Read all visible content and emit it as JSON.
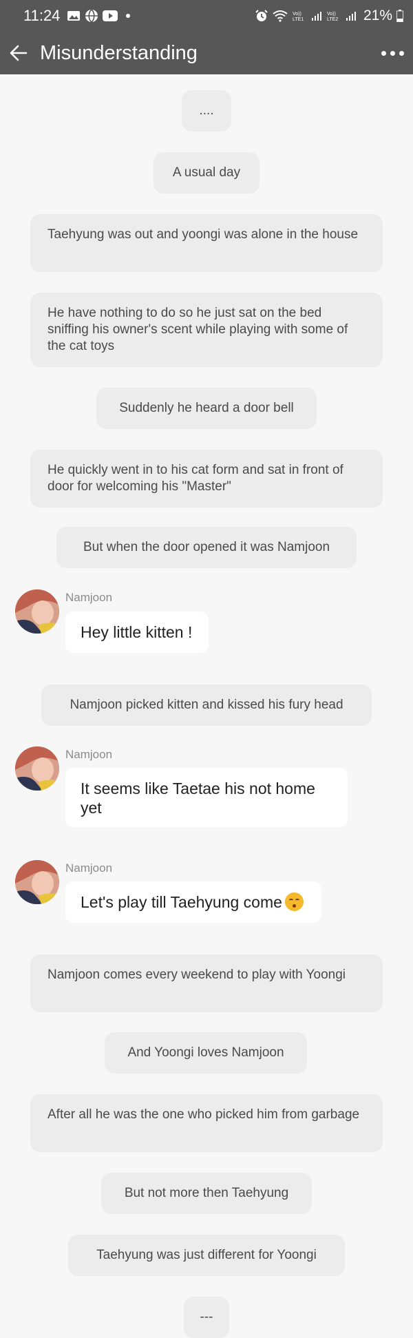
{
  "status_bar": {
    "time": "11:24",
    "battery": "21%",
    "icons": [
      "image-icon",
      "globe-icon",
      "youtube-icon",
      "notification-dot",
      "alarm-icon",
      "wifi-icon",
      "volte-lte1-icon",
      "signal-icon",
      "volte-lte2-icon",
      "signal-icon",
      "battery-icon"
    ]
  },
  "app_bar": {
    "title": "Misunderstanding",
    "back_icon": "arrow-left-icon",
    "more_icon": "more-horizontal-icon"
  },
  "messages": [
    {
      "type": "narration",
      "text": "...."
    },
    {
      "type": "narration",
      "text": "A usual day"
    },
    {
      "type": "narration",
      "text": "Taehyung was out and yoongi was alone in the house"
    },
    {
      "type": "narration",
      "text": "He have nothing to do so he just sat on the bed sniffing his owner's scent while playing with some of the cat toys"
    },
    {
      "type": "narration",
      "text": "Suddenly he heard a door bell"
    },
    {
      "type": "narration",
      "text": "He quickly went in to his cat form and sat in front of door for welcoming his \"Master\""
    },
    {
      "type": "narration",
      "text": "But when the door opened it was Namjoon"
    },
    {
      "type": "chat",
      "sender": "Namjoon",
      "text": "Hey little kitten !"
    },
    {
      "type": "narration",
      "text": "Namjoon picked kitten and kissed his fury head"
    },
    {
      "type": "chat",
      "sender": "Namjoon",
      "text": "It seems like Taetae his not home yet"
    },
    {
      "type": "chat",
      "sender": "Namjoon",
      "text": "Let's play till Taehyung come",
      "emoji": "kissing-face-icon"
    },
    {
      "type": "narration",
      "text": "Namjoon comes every weekend to play with Yoongi"
    },
    {
      "type": "narration",
      "text": "And Yoongi loves Namjoon"
    },
    {
      "type": "narration",
      "text": "After all he was the one who picked him from garbage"
    },
    {
      "type": "narration",
      "text": "But not more then Taehyung"
    },
    {
      "type": "narration",
      "text": "Taehyung was just different for Yoongi"
    },
    {
      "type": "narration",
      "text": "---"
    }
  ],
  "colors": {
    "bar": "#575757",
    "background": "#f7f7f7",
    "narration_bubble": "#ececec",
    "chat_bubble": "#ffffff"
  }
}
